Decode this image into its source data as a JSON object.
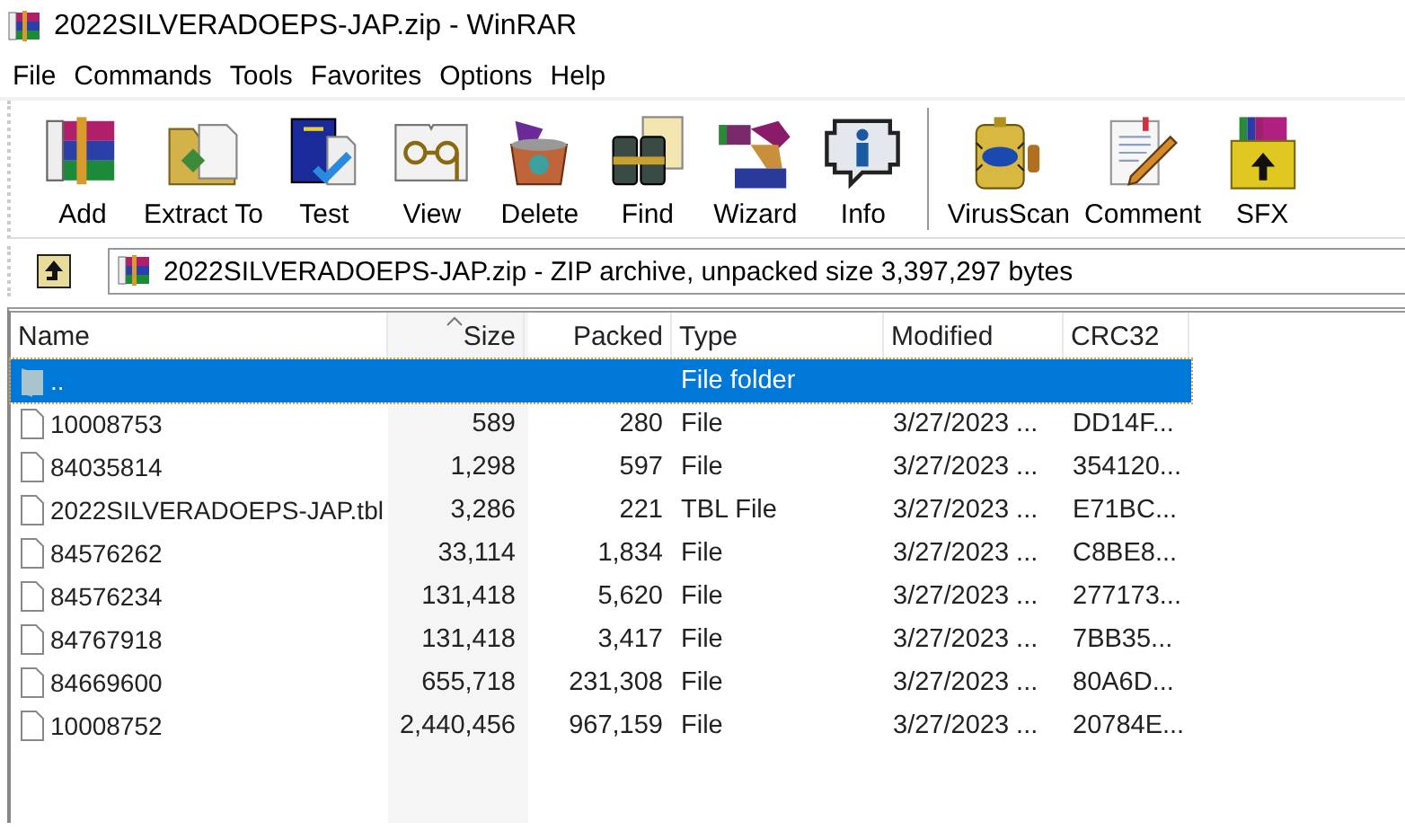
{
  "window": {
    "title": "2022SILVERADOEPS-JAP.zip - WinRAR"
  },
  "menu": [
    "File",
    "Commands",
    "Tools",
    "Favorites",
    "Options",
    "Help"
  ],
  "toolbar_groups": [
    [
      {
        "label": "Add"
      },
      {
        "label": "Extract To"
      },
      {
        "label": "Test"
      },
      {
        "label": "View"
      },
      {
        "label": "Delete"
      },
      {
        "label": "Find"
      },
      {
        "label": "Wizard"
      },
      {
        "label": "Info"
      }
    ],
    [
      {
        "label": "VirusScan"
      },
      {
        "label": "Comment"
      },
      {
        "label": "SFX"
      }
    ]
  ],
  "address": {
    "text": "2022SILVERADOEPS-JAP.zip - ZIP archive, unpacked size 3,397,297 bytes"
  },
  "table": {
    "columns": [
      {
        "label": "Name",
        "sorted": false
      },
      {
        "label": "Size",
        "sorted": true
      },
      {
        "label": "Packed",
        "sorted": false
      },
      {
        "label": "Type",
        "sorted": false
      },
      {
        "label": "Modified",
        "sorted": false
      },
      {
        "label": "CRC32",
        "sorted": false
      }
    ],
    "rows": [
      {
        "kind": "folder",
        "selected": true,
        "cells": [
          "..",
          "",
          "",
          "File folder",
          "",
          ""
        ]
      },
      {
        "kind": "file",
        "selected": false,
        "cells": [
          "10008753",
          "589",
          "280",
          "File",
          "3/27/2023 ...",
          "DD14F..."
        ]
      },
      {
        "kind": "file",
        "selected": false,
        "cells": [
          "84035814",
          "1,298",
          "597",
          "File",
          "3/27/2023 ...",
          "354120..."
        ]
      },
      {
        "kind": "file",
        "selected": false,
        "cells": [
          "2022SILVERADOEPS-JAP.tbl",
          "3,286",
          "221",
          "TBL File",
          "3/27/2023 ...",
          "E71BC..."
        ]
      },
      {
        "kind": "file",
        "selected": false,
        "cells": [
          "84576262",
          "33,114",
          "1,834",
          "File",
          "3/27/2023 ...",
          "C8BE8..."
        ]
      },
      {
        "kind": "file",
        "selected": false,
        "cells": [
          "84576234",
          "131,418",
          "5,620",
          "File",
          "3/27/2023 ...",
          "277173..."
        ]
      },
      {
        "kind": "file",
        "selected": false,
        "cells": [
          "84767918",
          "131,418",
          "3,417",
          "File",
          "3/27/2023 ...",
          "7BB35..."
        ]
      },
      {
        "kind": "file",
        "selected": false,
        "cells": [
          "84669600",
          "655,718",
          "231,308",
          "File",
          "3/27/2023 ...",
          "80A6D..."
        ]
      },
      {
        "kind": "file",
        "selected": false,
        "cells": [
          "10008752",
          "2,440,456",
          "967,159",
          "File",
          "3/27/2023 ...",
          "20784E..."
        ]
      }
    ]
  }
}
